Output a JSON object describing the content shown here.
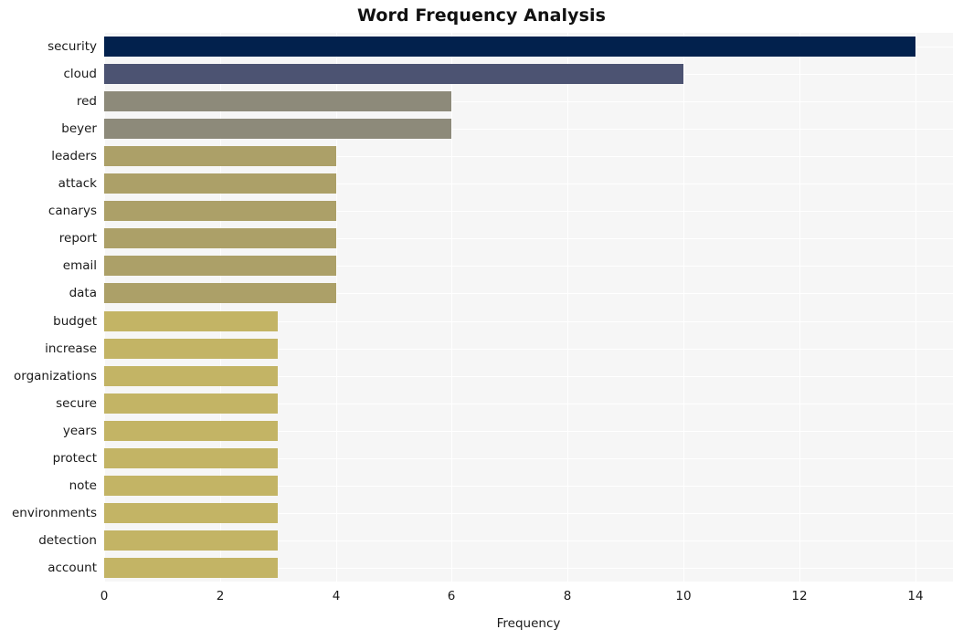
{
  "chart_data": {
    "type": "bar",
    "orientation": "horizontal",
    "title": "Word Frequency Analysis",
    "xlabel": "Frequency",
    "ylabel": "",
    "xlim": [
      0,
      14.65
    ],
    "xticks": [
      0,
      2,
      4,
      6,
      8,
      10,
      12,
      14
    ],
    "xtick_labels": [
      "0",
      "2",
      "4",
      "6",
      "8",
      "10",
      "12",
      "14"
    ],
    "grid": true,
    "grid_color": "#ffffff",
    "plot_background": "#f6f6f6",
    "legend": null,
    "categories": [
      "security",
      "cloud",
      "red",
      "beyer",
      "leaders",
      "attack",
      "canarys",
      "report",
      "email",
      "data",
      "budget",
      "increase",
      "organizations",
      "secure",
      "years",
      "protect",
      "note",
      "environments",
      "detection",
      "account"
    ],
    "values": [
      14,
      10,
      6,
      6,
      4,
      4,
      4,
      4,
      4,
      4,
      3,
      3,
      3,
      3,
      3,
      3,
      3,
      3,
      3,
      3
    ],
    "bar_colors": [
      "#02214d",
      "#4c5372",
      "#8d8a7a",
      "#8d8a7a",
      "#aca068",
      "#aca068",
      "#aca068",
      "#aca068",
      "#aca068",
      "#aca068",
      "#c3b465",
      "#c3b465",
      "#c3b465",
      "#c3b465",
      "#c3b465",
      "#c3b465",
      "#c3b465",
      "#c3b465",
      "#c3b465",
      "#c3b465"
    ]
  }
}
